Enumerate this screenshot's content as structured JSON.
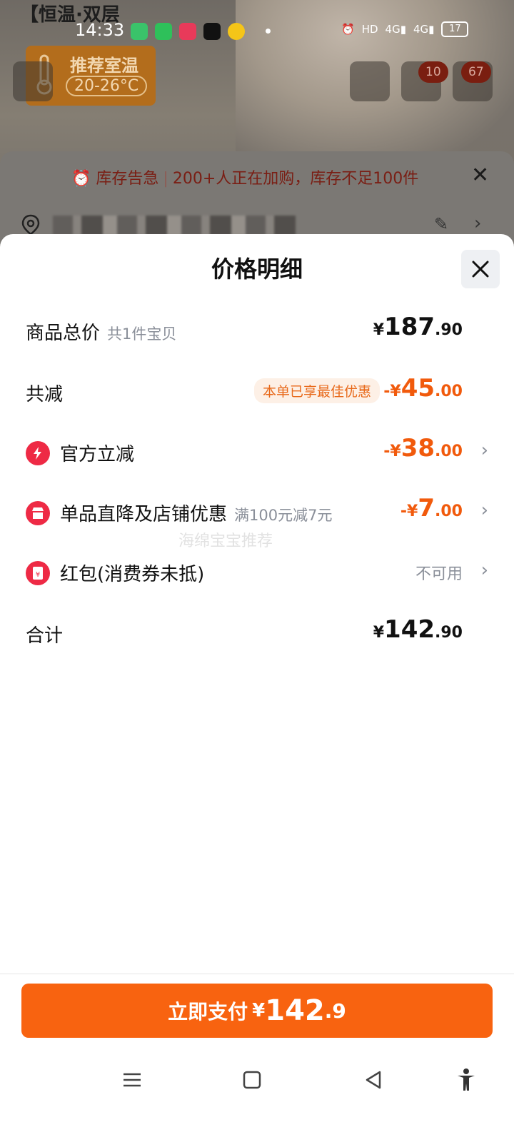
{
  "background": {
    "product_title": "【恒温·双层",
    "status_time": "14:33",
    "status_battery": "17",
    "temp_label": "推荐室温",
    "temp_range": "20-26°C",
    "cart_count": "10",
    "other_count": "67",
    "stock_alert": "库存告急",
    "stock_text": "200+人正在加购，库存不足100件"
  },
  "sheet": {
    "title": "价格明细",
    "rows": {
      "total": {
        "label": "商品总价",
        "sub": "共1件宝贝",
        "cur": "¥",
        "int": "187",
        "dec": ".90"
      },
      "discount": {
        "label": "共减",
        "tag": "本单已享最佳优惠",
        "cur": "-¥",
        "int": "45",
        "dec": ".00"
      },
      "official": {
        "label": "官方立减",
        "cur": "-¥",
        "int": "38",
        "dec": ".00"
      },
      "shop": {
        "label": "单品直降及店铺优惠",
        "sub": "满100元减7元",
        "cur": "-¥",
        "int": "7",
        "dec": ".00"
      },
      "redpacket": {
        "label": "红包(消费券未抵)",
        "status": "不可用"
      },
      "sum": {
        "label": "合计",
        "cur": "¥",
        "int": "142",
        "dec": ".90"
      }
    },
    "watermark": "海绵宝宝推荐"
  },
  "pay": {
    "label": "立即支付",
    "cur": "¥",
    "int": "142",
    "dec": ".9"
  },
  "colors": {
    "accent": "#f86310",
    "discount": "#f15a0c",
    "icon_red": "#ee2a45"
  }
}
